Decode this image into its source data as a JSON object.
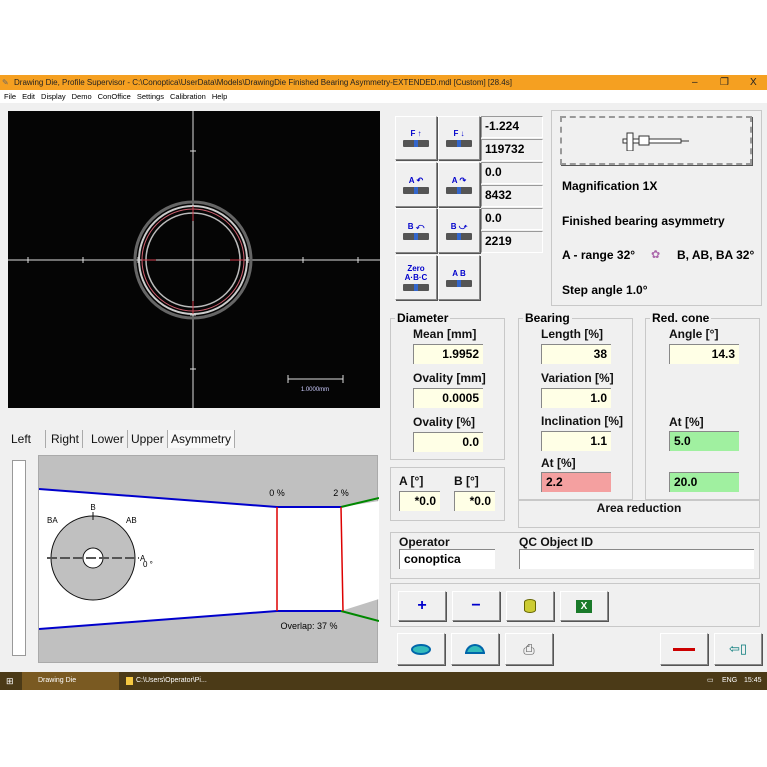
{
  "window": {
    "title": "Drawing Die, Profile Supervisor - C:\\Conoptica\\UserData\\Models\\DrawingDie Finished Bearing Asymmetry-EXTENDED.mdl [Custom]   [28.4s]",
    "minimize": "–",
    "maximize": "❐",
    "close": "X"
  },
  "menu": [
    "File",
    "Edit",
    "Display",
    "Demo",
    "ConOffice",
    "Settings",
    "Calibration",
    "Help"
  ],
  "camera": {
    "scale_label": "1.0000mm"
  },
  "tabs": [
    "Left",
    "Right",
    "Lower",
    "Upper",
    "Asymmetry"
  ],
  "active_tab": "Asymmetry",
  "asymmetry": {
    "label_0": "0 %",
    "label_2": "2 %",
    "overlap": "Overlap: 37 %",
    "b": "B",
    "ba": "BA",
    "ab": "AB",
    "a": "A",
    "deg": "0 °"
  },
  "adjust_buttons": [
    {
      "icon": "focus-up-icon",
      "label": "F ↑"
    },
    {
      "icon": "focus-down-icon",
      "label": "F ↓"
    },
    {
      "icon": "rotate-a-ccw-icon",
      "label": "A ↶"
    },
    {
      "icon": "rotate-a-cw-icon",
      "label": "A ↷"
    },
    {
      "icon": "rotate-b-back-icon",
      "label": "B ⤺"
    },
    {
      "icon": "rotate-b-fwd-icon",
      "label": "B ⤻"
    },
    {
      "icon": "zero-abc-icon",
      "label": "Zero A·B·C"
    },
    {
      "icon": "ab-icon",
      "label": "A B"
    }
  ],
  "readouts": [
    "-1.224",
    "119732",
    "0.0",
    "8432",
    "0.0",
    "2219"
  ],
  "info": {
    "magnification": "Magnification 1X",
    "mode": "Finished bearing asymmetry",
    "a_range": "A - range 32°",
    "b_range": "B, AB, BA 32°",
    "step": "Step angle 1.0°"
  },
  "diameter": {
    "title": "Diameter",
    "mean_label": "Mean [mm]",
    "mean": "1.9952",
    "ovality_mm_label": "Ovality [mm]",
    "ovality_mm": "0.0005",
    "ovality_pct_label": "Ovality [%]",
    "ovality_pct": "0.0"
  },
  "angles": {
    "a_label": "A [°]",
    "a": "*0.0",
    "b_label": "B [°]",
    "b": "*0.0"
  },
  "bearing": {
    "title": "Bearing",
    "length_label": "Length [%]",
    "length": "38",
    "variation_label": "Variation [%]",
    "variation": "1.0",
    "inclination_label": "Inclination [%]",
    "inclination": "1.1",
    "at_label": "At [%]",
    "at": "2.2"
  },
  "red_cone": {
    "title": "Red. cone",
    "angle_label": "Angle [°]",
    "angle": "14.3",
    "at_label": "At [%]",
    "at": "5.0",
    "at2": "20.0"
  },
  "area_reduction": "Area reduction",
  "operator": {
    "label": "Operator",
    "value": "conoptica"
  },
  "qc": {
    "label": "QC Object ID",
    "value": ""
  },
  "colors": {
    "ok": "#a0f0a0",
    "bad": "#f4a0a0",
    "field": "#ffffe6",
    "titlebar": "#f5a021"
  },
  "taskbar": {
    "app1": "Drawing Die",
    "app2": "C:\\Users\\Operator\\Pi...",
    "lang": "ENG",
    "time": "15:45"
  }
}
